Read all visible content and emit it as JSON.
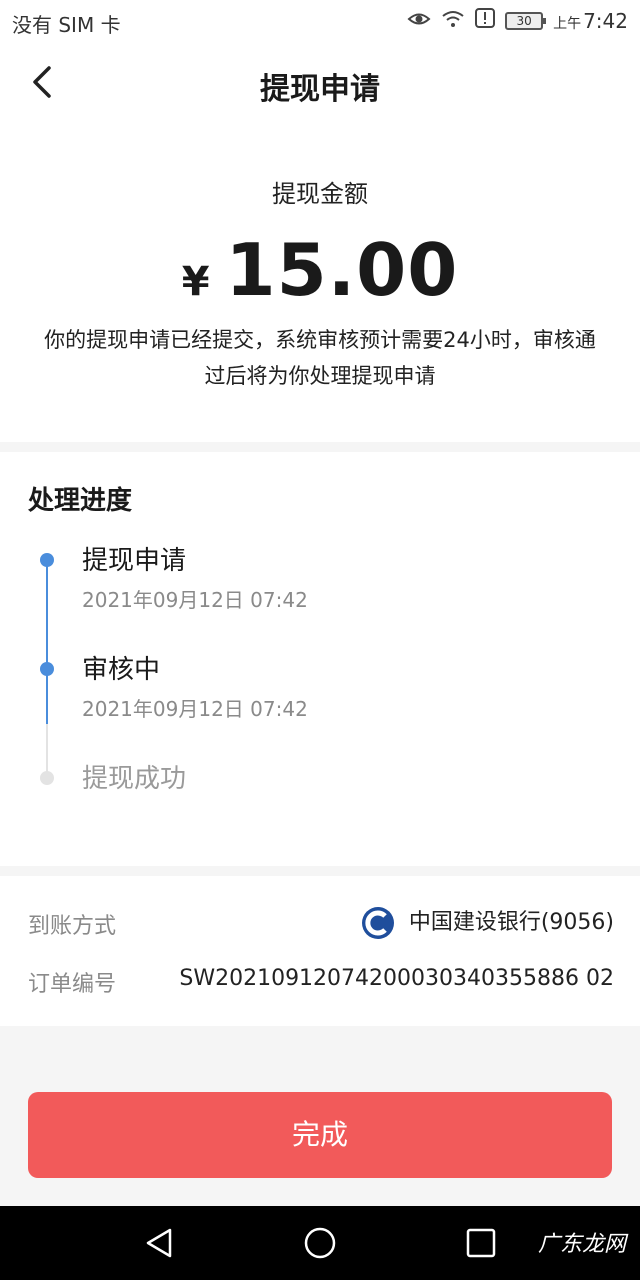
{
  "status_bar": {
    "carrier": "没有 SIM 卡",
    "battery": "30",
    "time_prefix": "上午",
    "time": "7:42",
    "icons": [
      "eye-icon",
      "wifi-icon",
      "alert-icon",
      "battery-icon"
    ]
  },
  "nav": {
    "back_icon": "chevron-left-icon",
    "title": "提现申请"
  },
  "amount": {
    "label": "提现金额",
    "currency": "¥",
    "value": "15.00",
    "note": "你的提现申请已经提交，系统审核预计需要24小时，审核通过后将为你处理提现申请"
  },
  "progress": {
    "title": "处理进度",
    "steps": [
      {
        "title": "提现申请",
        "time": "2021年09月12日 07:42",
        "state": "done"
      },
      {
        "title": "审核中",
        "time": "2021年09月12日 07:42",
        "state": "done"
      },
      {
        "title": "提现成功",
        "time": "",
        "state": "pending"
      }
    ],
    "active_color": "#4a8ddc",
    "inactive_color": "#e3e3e3"
  },
  "info": {
    "method_label": "到账方式",
    "method_value": "中国建设银行(9056)",
    "bank_icon": "ccb-bank-icon",
    "order_label": "订单编号",
    "order_value": "SW20210912074200030340355886 02"
  },
  "actions": {
    "done_label": "完成",
    "done_color": "#f25a5a"
  },
  "system_nav": {
    "icons": [
      "back-triangle-icon",
      "home-circle-icon",
      "recents-square-icon"
    ],
    "watermark": "广东龙网"
  }
}
